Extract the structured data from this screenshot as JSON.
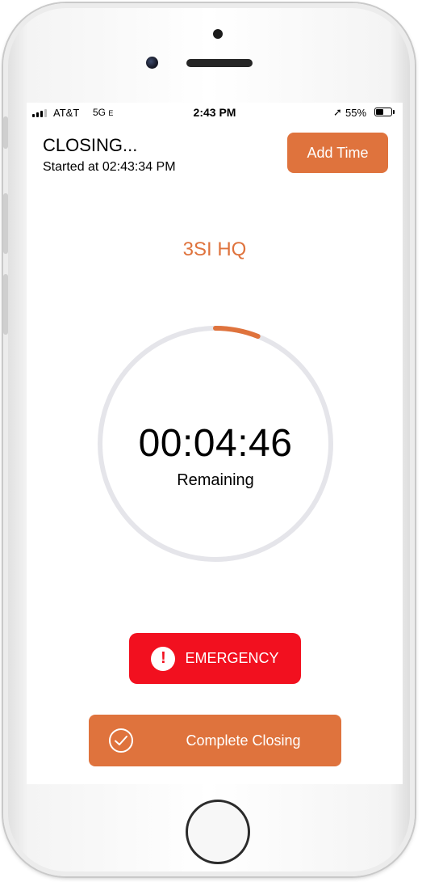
{
  "status_bar": {
    "carrier": "AT&T",
    "network": "5G",
    "network_suffix": "E",
    "time": "2:43 PM",
    "battery_percent": "55%",
    "battery_level": 0.55,
    "location_icon": "location-arrow-icon"
  },
  "header": {
    "title": "CLOSING...",
    "started": "Started at 02:43:34 PM",
    "add_time_label": "Add Time"
  },
  "location_name": "3SI HQ",
  "timer": {
    "value": "00:04:46",
    "label": "Remaining",
    "progress_fraction": 0.06
  },
  "buttons": {
    "emergency_label": "EMERGENCY",
    "complete_label": "Complete Closing"
  },
  "colors": {
    "accent": "#df733d",
    "emergency": "#f2101f",
    "ring_track": "#e5e5ea"
  }
}
